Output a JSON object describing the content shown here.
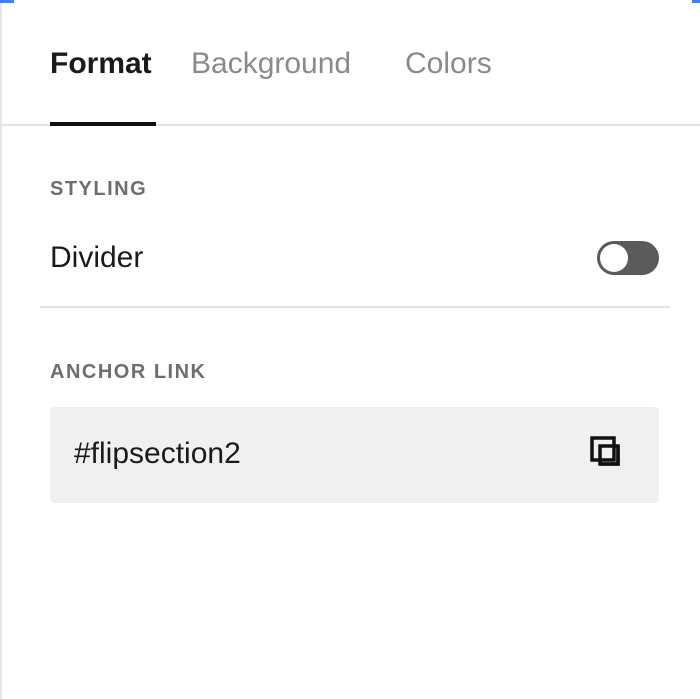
{
  "tabs": [
    {
      "label": "Format",
      "active": true
    },
    {
      "label": "Background",
      "active": false
    },
    {
      "label": "Colors",
      "active": false
    }
  ],
  "styling": {
    "section_label": "STYLING",
    "divider_label": "Divider",
    "divider_enabled": false
  },
  "anchor": {
    "section_label": "ANCHOR LINK",
    "value": "#flipsection2",
    "copy_icon": "copy-icon"
  },
  "colors": {
    "accent": "#3b82f6",
    "toggle_off": "#5b5b5b",
    "field_bg": "#f0f0f0",
    "active_tab": "#1a1a1a",
    "inactive_tab": "#8a8a8a"
  }
}
